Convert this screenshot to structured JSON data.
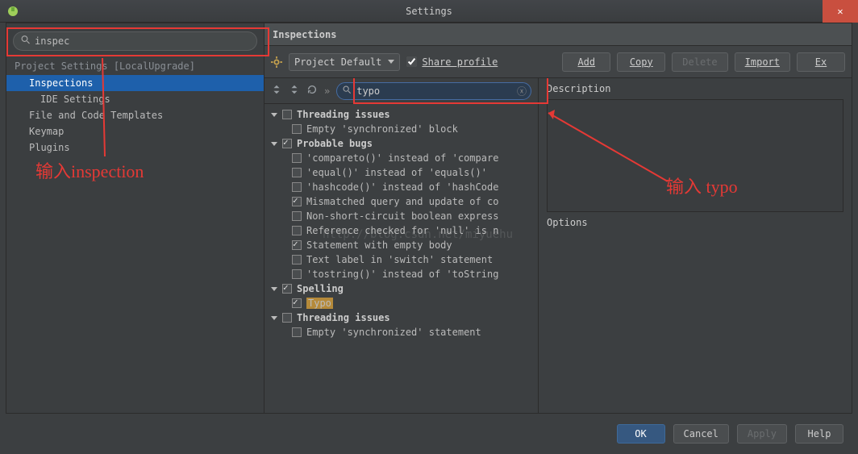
{
  "window": {
    "title": "Settings",
    "close": "✕"
  },
  "sidebar": {
    "search": {
      "value": "inspec",
      "placeholder": ""
    },
    "group": "Project Settings [LocalUpgrade]",
    "items": [
      "Inspections",
      "IDE Settings",
      "File and Code Templates",
      "Keymap",
      "Plugins"
    ]
  },
  "main": {
    "header": "Inspections",
    "profile_combo": "Project Default",
    "share_label": "Share profile",
    "buttons": {
      "add": "Add",
      "copy": "Copy",
      "delete": "Delete",
      "import": "Import",
      "export": "Ex"
    },
    "filter": {
      "value": "typo"
    },
    "sep": "»",
    "desc_label": "Description",
    "opt_label": "Options",
    "tree": {
      "g1": "Threading issues",
      "g1_i1": "Empty 'synchronized' block",
      "g2": "Probable bugs",
      "g2_items": [
        "'compareto()' instead of 'compare",
        "'equal()' instead of 'equals()'",
        "'hashcode()' instead of 'hashCode",
        "Mismatched query and update of co",
        "Non-short-circuit boolean express",
        "Reference checked for 'null' is n",
        "Statement with empty body",
        "Text label in 'switch' statement",
        "'tostring()' instead of 'toString"
      ],
      "g3": "Spelling",
      "g3_i1": "Typo",
      "g4": "Threading issues",
      "g4_i1": "Empty 'synchronized' statement"
    }
  },
  "footer": {
    "ok": "OK",
    "cancel": "Cancel",
    "apply": "Apply",
    "help": "Help"
  },
  "annot": {
    "left": "输入inspection",
    "right": "输入 typo",
    "watermark": "http://blog.csdn.net/miyuehu"
  }
}
